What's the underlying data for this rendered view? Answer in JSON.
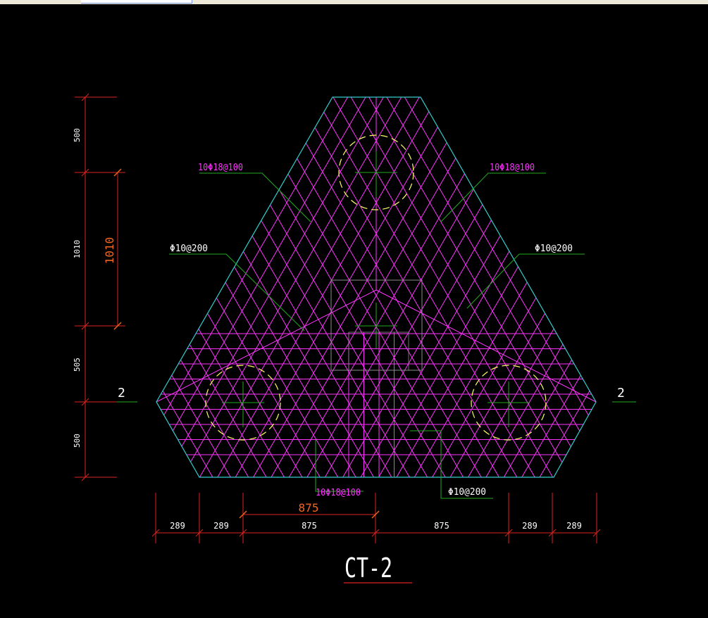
{
  "colors": {
    "background": "#000000",
    "outline": "#33cccc",
    "rebar": "#ff33ff",
    "leader": "#22aa22",
    "dimension": "#dd2222",
    "dim_text": "#ffffff",
    "accent_text": "#ee6622",
    "pile": "#ffff66",
    "column": "#8c8c8c"
  },
  "drawing": {
    "title": "CT-2",
    "section_mark_left": "2",
    "section_mark_right": "2",
    "labels": {
      "rebar_top_left": "10Φ18@100",
      "rebar_top_right": "10Φ18@100",
      "rebar_bottom": "10Φ18@100",
      "stirrup_left": "Φ10@200",
      "stirrup_right": "Φ10@200",
      "stirrup_bottom": "Φ10@200"
    },
    "left_dims": [
      "500",
      "1010",
      "505",
      "500"
    ],
    "left_dim_inner": "1010",
    "bottom_dims": [
      "289",
      "289",
      "875",
      "875",
      "289",
      "289"
    ],
    "bottom_dim_upper": "875"
  }
}
